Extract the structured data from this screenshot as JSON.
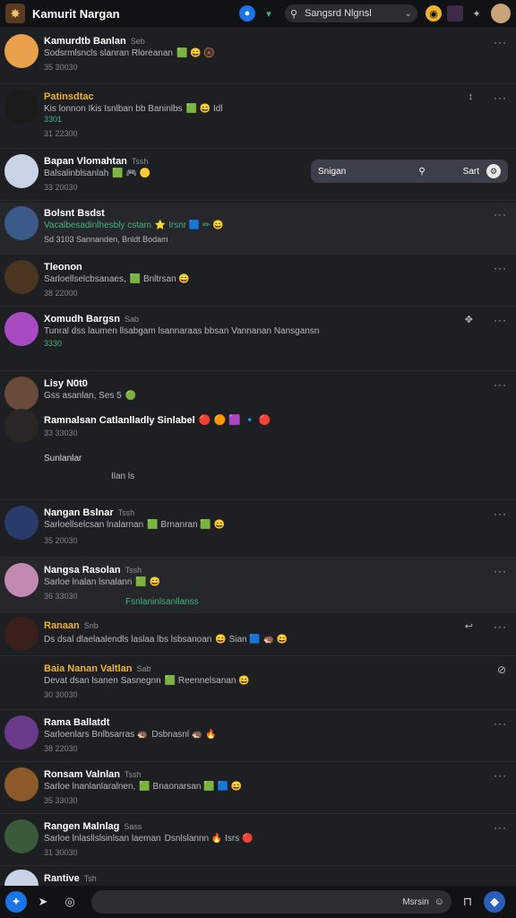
{
  "app": {
    "title": "Kamurit Nargan"
  },
  "search": {
    "value": "Sangsrd Nlgnsl"
  },
  "popup": {
    "label": "Snigan",
    "action": "Sart"
  },
  "composer": {
    "label": "Msrsin"
  },
  "posts": [
    {
      "name": "Kamurdtb Banlan",
      "tag": "Seb",
      "body": "Sodsrmlsncls slanran Rloreanan",
      "emojis": "🟩 😄 🛞",
      "time": "35 30030"
    },
    {
      "name": "Patinsdtac",
      "tag": "",
      "body": "Kis lonnon Ikis Isnlban bb Baninlbs",
      "emojis": "🟩 😄 Idl",
      "time": "31 22300",
      "sub": "3301"
    },
    {
      "name": "Bapan Vlomahtan",
      "tag": "Tssh",
      "body": "Balsalinblsanlah",
      "emojis": "🟩 🎮 🟡",
      "time": "33 20030"
    },
    {
      "name": "Bolsnt Bsdst",
      "tag": "",
      "body": "Vacalbesadinlhesbly cstam",
      "emojis": "⭐ Irsnr 🟦 ✏ 😄",
      "time": "",
      "sub": "Sd 3103 Sannanden, Bnldt Bodam"
    },
    {
      "name": "Tleonon",
      "tag": "",
      "body": "Sarloellselcbsanaes,",
      "emojis": "🟩 Bnltrsan 😄",
      "time": "38 22000"
    },
    {
      "name": "Xomudh Bargsn",
      "tag": "Sab",
      "body": "Tunral dss laumen llsabgam lsannaraas bbsan Vannanan Nansgansn",
      "emojis": "",
      "time": "3330"
    },
    {
      "name": "Lisy N0t0",
      "tag": "",
      "body": "Gss asanlan, Ses 5",
      "emojis": "🟢",
      "time": ""
    },
    {
      "name": "Ramnalsan Catlanlladly Sinlabel",
      "tag": "",
      "body": "",
      "emojis": "🔴 🟠 🟪 🔹 🔴",
      "time": "33 33030",
      "sub": "Sunlanlar",
      "sub2": "Ilan ls"
    },
    {
      "name": "Nangan Bslnar",
      "tag": "Tssh",
      "body": "Sarloellselcsan lnalarnan",
      "emojis": "🟩 Brnanran 🟩 😄",
      "time": "35 20030"
    },
    {
      "name": "Nangsa Rasolan",
      "tag": "Tssh",
      "body": "Sarloe lnalan lsnalann",
      "emojis": "🟩 😄",
      "time": "36 33030",
      "sub": "Fsnlaninlsanllanss"
    },
    {
      "name": "Ranaan",
      "tag": "Snb",
      "body": "Ds dsal dlaelaalendls laslaa lbs lsbsanoan",
      "emojis": "😄 Sian 🟦 🦔 😄",
      "time": ""
    },
    {
      "name": "Baia Nanan Valtlan",
      "tag": "Sab",
      "body": "Devat dsan lsanen Sasnegnn",
      "emojis": "🟩 Reennelsanan 😄",
      "time": "30 30030"
    },
    {
      "name": "Rama Ballatdt",
      "tag": "",
      "body": "Sarloenlars Bnlbsarras 🦔",
      "emojis": "Dsbnasnl 🦔 🔥",
      "time": "38 22030"
    },
    {
      "name": "Ronsam Valnlan",
      "tag": "Tssh",
      "body": "Sarloe lnanlanlaralnen,",
      "emojis": "🟩 Bnaonarsan 🟩 🟦 😄",
      "time": "35 33030"
    },
    {
      "name": "Rangen Malnlag",
      "tag": "Sass",
      "body": "Sarloe lnlasllslsinlsan laeman",
      "emojis": "Dsnlslannn 🔥 Isrs 🔴",
      "time": "31 30030"
    },
    {
      "name": "Rantive",
      "tag": "Tsh",
      "body": "",
      "emojis": "",
      "time": ""
    }
  ]
}
